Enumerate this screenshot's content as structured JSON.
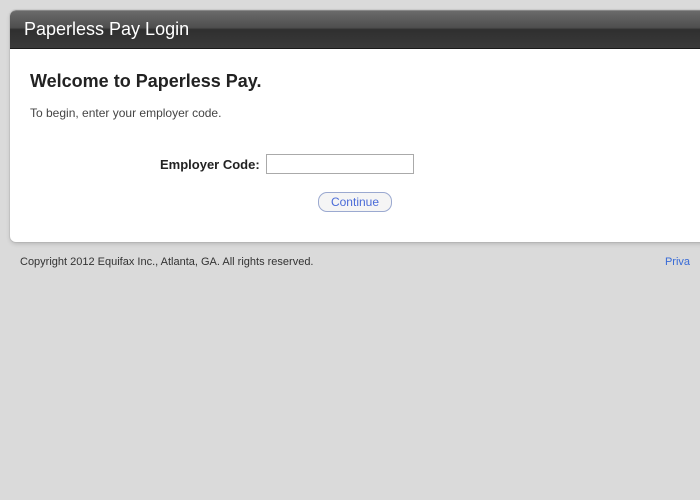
{
  "header": {
    "title": "Paperless Pay Login"
  },
  "main": {
    "welcome": "Welcome to Paperless Pay.",
    "instruction": "To begin, enter your employer code.",
    "form": {
      "employer_code_label": "Employer Code:",
      "employer_code_value": "",
      "continue_label": "Continue"
    }
  },
  "footer": {
    "copyright": "Copyright 2012 Equifax Inc., Atlanta, GA. All rights reserved.",
    "link_label": "Priva"
  }
}
